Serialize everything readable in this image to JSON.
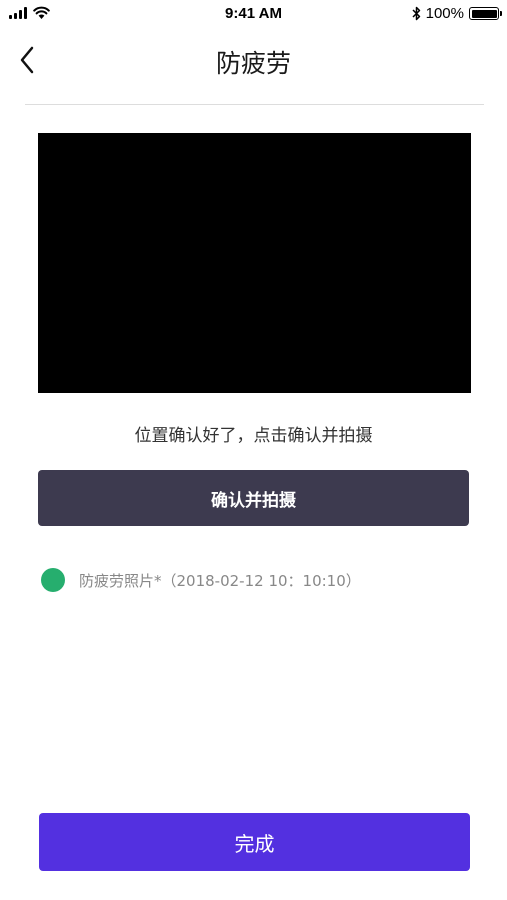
{
  "status_bar": {
    "time": "9:41 AM",
    "battery_text": "100%",
    "icons": [
      "signal-icon",
      "wifi-icon",
      "bluetooth-icon",
      "battery-icon"
    ]
  },
  "nav": {
    "title": "防疲劳",
    "back_icon": "back-chevron-icon"
  },
  "camera": {
    "hint": "位置确认好了，点击确认并拍摄",
    "confirm_label": "确认并拍摄"
  },
  "photos": [
    {
      "label": "防疲劳照片*（2018-02-12 10：10:10）",
      "status_color": "#26ae6e"
    }
  ],
  "footer": {
    "done_label": "完成"
  },
  "colors": {
    "accent": "#5330e0",
    "confirm_button": "#3d3a4f",
    "success": "#26ae6e"
  }
}
